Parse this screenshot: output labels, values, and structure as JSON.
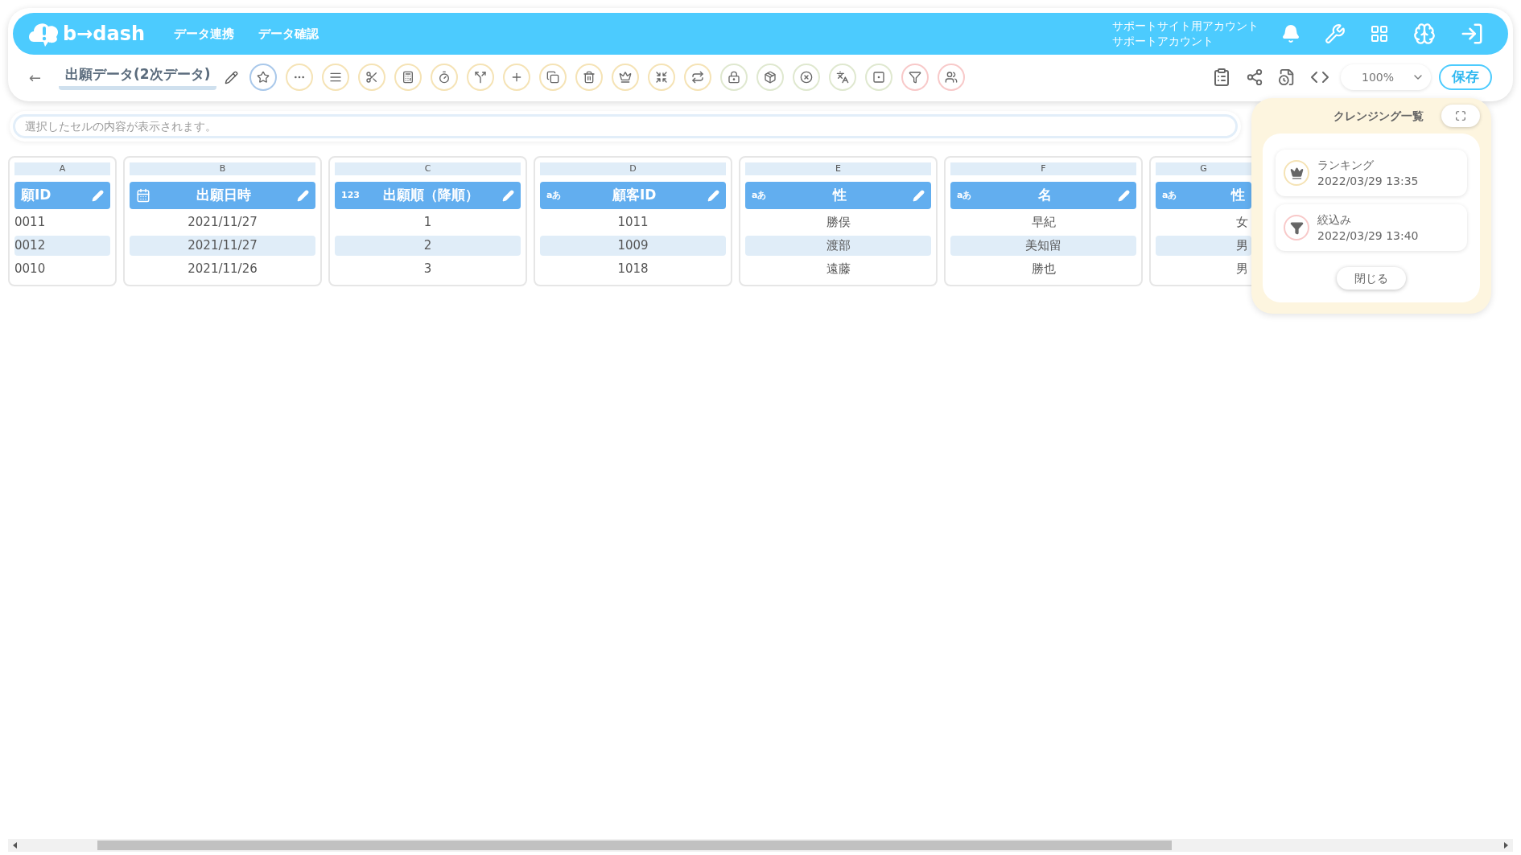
{
  "header": {
    "logo": "b→dash",
    "nav": [
      "データ連携",
      "データ確認"
    ],
    "account": [
      "サポートサイト用アカウント",
      "サポートアカウント"
    ]
  },
  "toolbar": {
    "back": "←",
    "title": "出願データ(2次データ)",
    "tools": [
      {
        "color": "#a9c8ea"
      },
      {
        "color": "#f5e3b5"
      },
      {
        "color": "#f5e3b5"
      },
      {
        "color": "#f5e3b5"
      },
      {
        "color": "#f5e3b5"
      },
      {
        "color": "#f5e3b5"
      },
      {
        "color": "#f5e3b5"
      },
      {
        "color": "#f5e3b5"
      },
      {
        "color": "#f5e3b5"
      },
      {
        "color": "#f5e3b5"
      },
      {
        "color": "#f5e3b5"
      },
      {
        "color": "#f5e3b5"
      },
      {
        "color": "#f5e3b5"
      },
      {
        "color": "#dfe8cf"
      },
      {
        "color": "#dfe8cf"
      },
      {
        "color": "#dfe8cf"
      },
      {
        "color": "#dfe8cf"
      },
      {
        "color": "#dfe8cf"
      },
      {
        "color": "#f8c9c9"
      },
      {
        "color": "#f8c9c9"
      }
    ],
    "zoom": "100%",
    "save": "保存"
  },
  "cell_bar": {
    "placeholder": "選択したセルの内容が表示されます。"
  },
  "columns": [
    {
      "letter": "A",
      "title": "願ID",
      "cut": true,
      "cells": [
        "0011",
        "0012",
        "0010"
      ]
    },
    {
      "letter": "B",
      "title": "出願日時",
      "cut": false,
      "kind": "date",
      "cells": [
        "2021/11/27",
        "2021/11/27",
        "2021/11/26"
      ]
    },
    {
      "letter": "C",
      "title": "出願順（降順）",
      "cut": false,
      "kind": "number",
      "type_label": "123",
      "cells": [
        "1",
        "2",
        "3"
      ]
    },
    {
      "letter": "D",
      "title": "顧客ID",
      "cut": false,
      "kind": "text",
      "type_label": "aあ",
      "cells": [
        "1011",
        "1009",
        "1018"
      ]
    },
    {
      "letter": "E",
      "title": "性",
      "cut": false,
      "kind": "text",
      "type_label": "aあ",
      "cells": [
        "勝俣",
        "渡部",
        "遠藤"
      ]
    },
    {
      "letter": "F",
      "title": "名",
      "cut": false,
      "kind": "text",
      "type_label": "aあ",
      "cells": [
        "早紀",
        "美知留",
        "勝也"
      ]
    },
    {
      "letter": "G",
      "title": "性",
      "kind": "text",
      "type_label": "aあ",
      "cut": true,
      "cells": [
        "女",
        "男",
        "男"
      ]
    }
  ],
  "cleansing_panel": {
    "title": "クレンジング一覧",
    "items": [
      {
        "kind": "ranking",
        "name": "ランキング",
        "time": "2022/03/29 13:35",
        "color": "#f5e3b5"
      },
      {
        "kind": "filter",
        "name": "絞込み",
        "time": "2022/03/29 13:40",
        "color": "#f8c9c9"
      }
    ],
    "close": "閉じる"
  }
}
